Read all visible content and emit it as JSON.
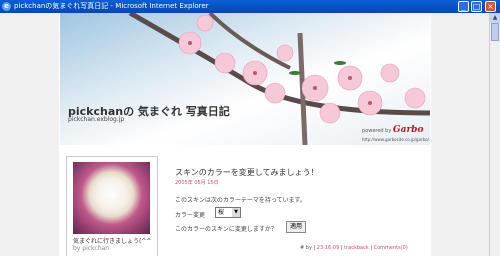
{
  "window": {
    "title": "pickchanの気まぐれ写真日記 - Microsoft Internet Explorer"
  },
  "blog": {
    "title": "pickchanの 気まぐれ 写真日記",
    "url": "pickchan.exblog.jp"
  },
  "header": {
    "powered_by": "powered by",
    "brand": "Garbo",
    "brand_url": "http://www.garbosite.co.jp/garbo/"
  },
  "sidebar": {
    "caption": "気まぐれに行きましょう(^^",
    "by": "by pickchan"
  },
  "post": {
    "title": "スキンのカラーを変更してみましょう！",
    "date": "2005年 05月 15日",
    "p1": "このスキンは次のカラーテーマを持っています。",
    "color_label": "カラー変更",
    "select_value": "桜",
    "p2": "このカラーのスキンに変更しますか？",
    "apply_label": "適用"
  },
  "footer": {
    "by": "# by",
    "time": "23:16:09",
    "trackback": "trackback",
    "comments": "Comments(0)",
    "sep": "|"
  }
}
